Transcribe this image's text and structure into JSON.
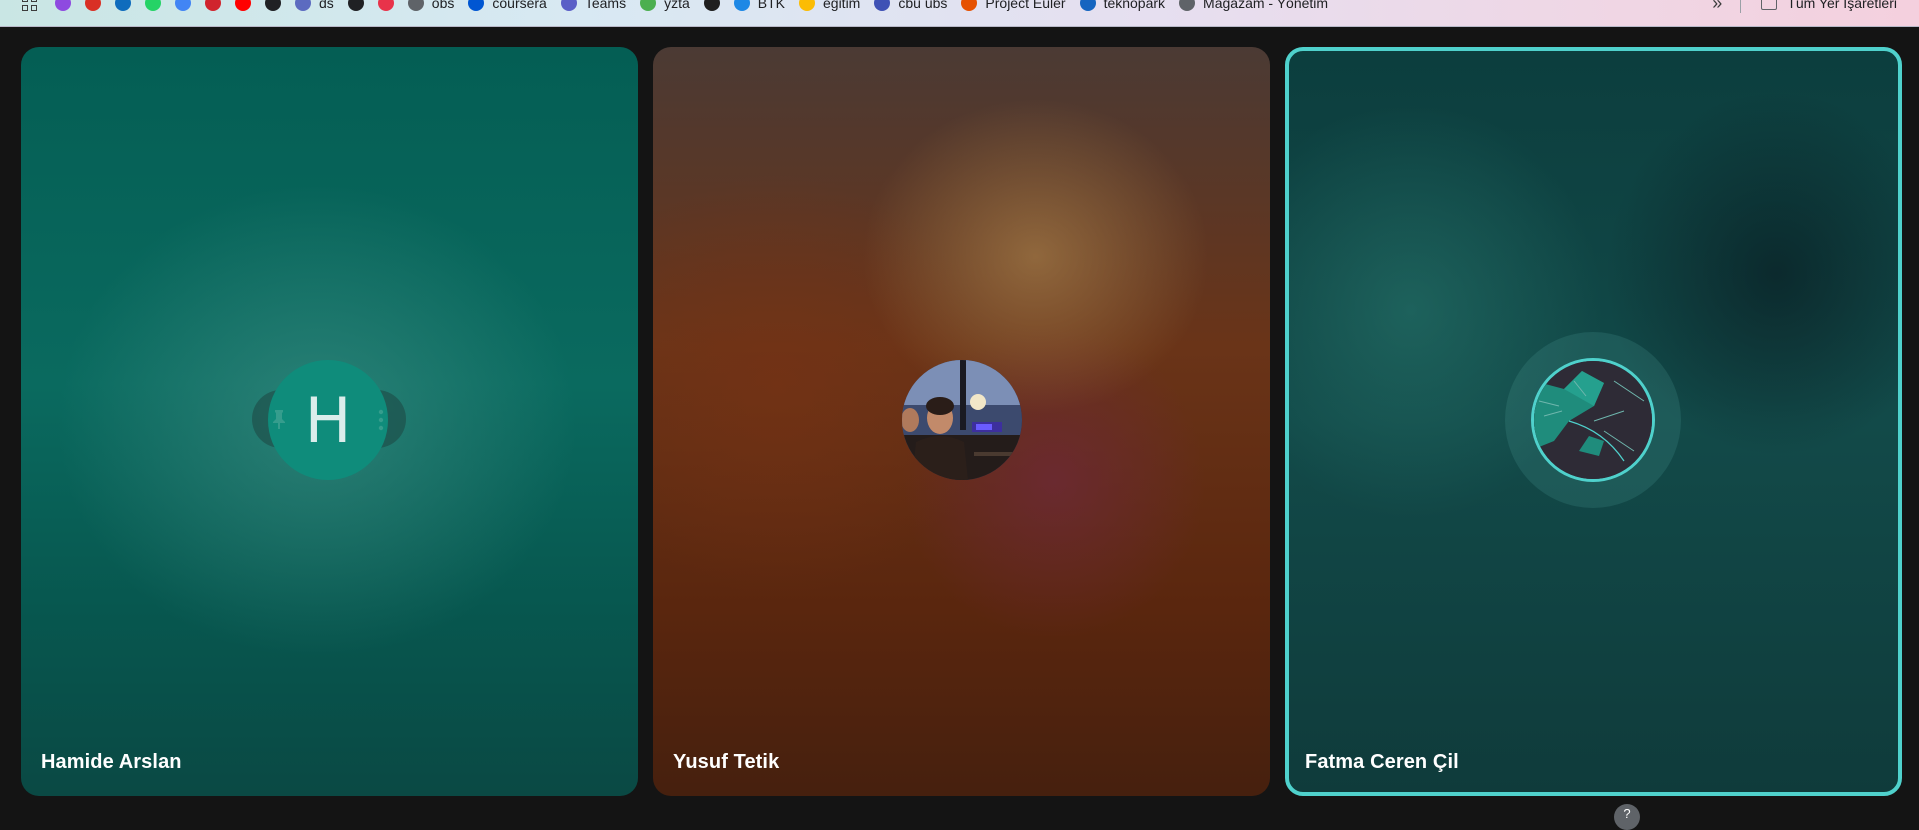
{
  "bookmarks_bar": {
    "items": [
      {
        "label": "",
        "icon": "purple-app-icon",
        "color": "#8e4ae0"
      },
      {
        "label": "",
        "icon": "gmail-icon",
        "color": "#d93025"
      },
      {
        "label": "",
        "icon": "outlook-icon",
        "color": "#0f6cbd"
      },
      {
        "label": "",
        "icon": "whatsapp-icon",
        "color": "#25d366"
      },
      {
        "label": "",
        "icon": "translate-icon",
        "color": "#4285f4"
      },
      {
        "label": "",
        "icon": "red-app-icon",
        "color": "#d0242d"
      },
      {
        "label": "",
        "icon": "youtube-icon",
        "color": "#ff0000"
      },
      {
        "label": "",
        "icon": "openai-icon",
        "color": "#202124"
      },
      {
        "label": "ds",
        "icon": "globe-link-icon",
        "color": "#5c6bc0"
      },
      {
        "label": "",
        "icon": "github-icon",
        "color": "#202124"
      },
      {
        "label": "",
        "icon": "music-icon",
        "color": "#e8334a"
      },
      {
        "label": "obs",
        "icon": "globe-icon",
        "color": "#5f6368"
      },
      {
        "label": "coursera",
        "icon": "coursera-icon",
        "color": "#0056d2"
      },
      {
        "label": "Teams",
        "icon": "teams-icon",
        "color": "#5b5fc7"
      },
      {
        "label": "yzta",
        "icon": "yzta-icon",
        "color": "#4caf50"
      },
      {
        "label": "",
        "icon": "v-app-icon",
        "color": "#1f1f1f"
      },
      {
        "label": "BTK",
        "icon": "btk-icon",
        "color": "#1e88e5"
      },
      {
        "label": "eğitim",
        "icon": "drive-icon",
        "color": "#fbbc04"
      },
      {
        "label": "cbu ubs",
        "icon": "cbu-icon",
        "color": "#3f51b5"
      },
      {
        "label": "Project Euler",
        "icon": "pe-icon",
        "color": "#e65100"
      },
      {
        "label": "teknopark",
        "icon": "teknopark-icon",
        "color": "#1565c0"
      },
      {
        "label": "Mağazam - Yönetim",
        "icon": "globe-icon",
        "color": "#5f6368"
      }
    ],
    "all_bookmarks_label": "Tüm Yer İşaretleri"
  },
  "participants": [
    {
      "name": "Hamide Arslan",
      "avatar_initial": "H",
      "avatar_color": "#0f8c7b"
    },
    {
      "name": "Yusuf Tetik"
    },
    {
      "name": "Fatma Ceren Çil",
      "active_speaker_color": "#4fd1cc"
    }
  ],
  "bottom_badge": "?"
}
